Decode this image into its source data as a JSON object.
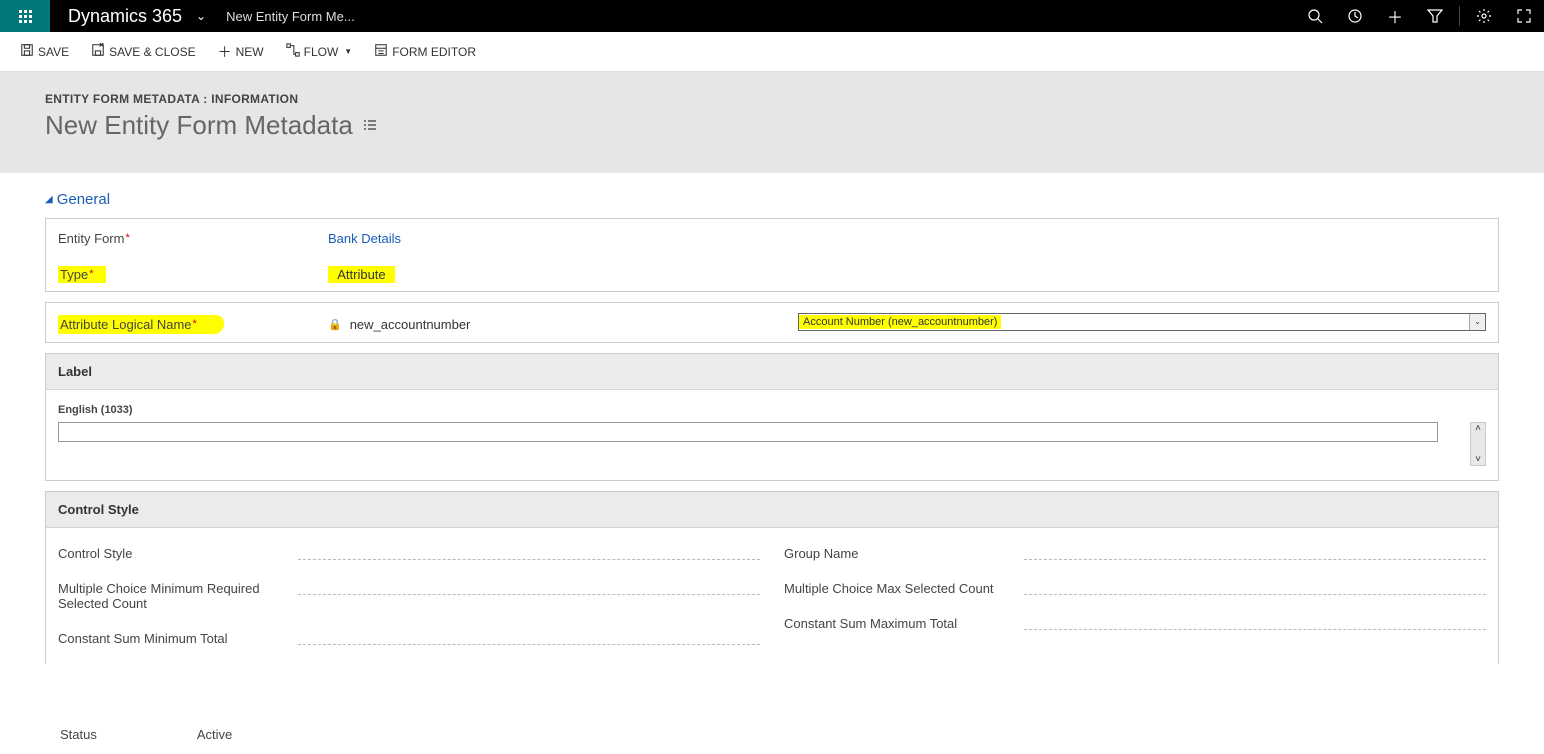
{
  "topbar": {
    "app_title": "Dynamics 365",
    "breadcrumb": "New Entity Form Me..."
  },
  "commands": {
    "save": "SAVE",
    "save_close": "SAVE & CLOSE",
    "new": "NEW",
    "flow": "FLOW",
    "form_editor": "FORM EDITOR"
  },
  "header": {
    "entity_line": "ENTITY FORM METADATA : INFORMATION",
    "record_title": "New Entity Form Metadata"
  },
  "section_general": "General",
  "fields": {
    "entity_form_label": "Entity Form",
    "entity_form_value": "Bank Details",
    "type_label": "Type",
    "type_value": "Attribute",
    "attr_logical_label": "Attribute Logical Name",
    "attr_logical_value": "new_accountnumber",
    "attr_picker_value": "Account Number (new_accountnumber)"
  },
  "label_section": {
    "title": "Label",
    "english_label": "English (1033)"
  },
  "control_style_section": {
    "title": "Control Style",
    "control_style_label": "Control Style",
    "group_name_label": "Group Name",
    "mc_min_label": "Multiple Choice Minimum Required Selected Count",
    "mc_max_label": "Multiple Choice Max Selected Count",
    "cs_min_label": "Constant Sum Minimum Total",
    "cs_max_label": "Constant Sum Maximum Total"
  },
  "status": {
    "label": "Status",
    "value": "Active"
  }
}
